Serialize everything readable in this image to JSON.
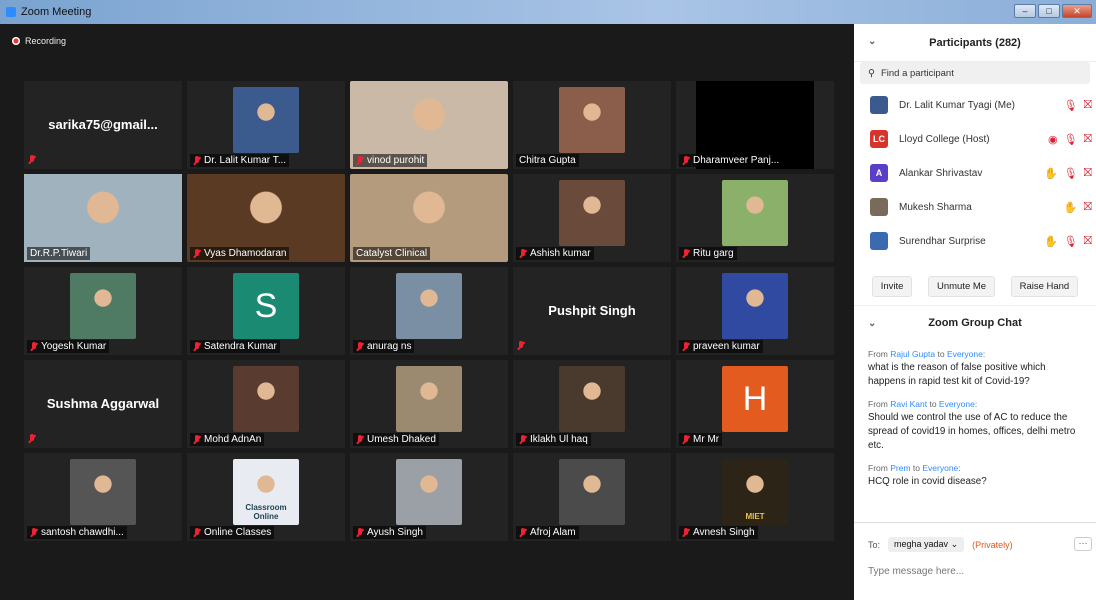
{
  "window": {
    "title": "Zoom Meeting",
    "min": "‒",
    "max": "□",
    "close": "✕"
  },
  "recording": "Recording",
  "tiles": [
    {
      "name": "sarika75@gmail...",
      "type": "name"
    },
    {
      "name": "Dr. Lalit Kumar T...",
      "type": "photo",
      "color": "#3b5b8f"
    },
    {
      "name": "vinod purohit",
      "type": "wide",
      "color": "#c9b9a6"
    },
    {
      "name": "Chitra Gupta",
      "type": "photo",
      "color": "#8a5e4a"
    },
    {
      "name": "Dharamveer Panj...",
      "type": "black"
    },
    {
      "name": "Dr.R.P.Tiwari",
      "type": "wide",
      "color": "#9fb2bd",
      "active": true
    },
    {
      "name": "Vyas Dhamodaran",
      "type": "wide",
      "color": "#5a3a22"
    },
    {
      "name": "Catalyst Clinical",
      "type": "wide",
      "color": "#b59b7d"
    },
    {
      "name": "Ashish kumar",
      "type": "photo",
      "color": "#6a4a3a"
    },
    {
      "name": "Ritu garg",
      "type": "photo",
      "color": "#8bb06a"
    },
    {
      "name": "Yogesh Kumar",
      "type": "photo",
      "color": "#4f7a63"
    },
    {
      "name": "Satendra Kumar",
      "type": "avatar-s",
      "letter": "S"
    },
    {
      "name": "anurag ns",
      "type": "photo",
      "color": "#7a8ea4"
    },
    {
      "name": "Pushpit Singh",
      "type": "name"
    },
    {
      "name": "praveen kumar",
      "type": "photo",
      "color": "#2f4aa0"
    },
    {
      "name": "Sushma Aggarwal",
      "type": "name"
    },
    {
      "name": "Mohd AdnAn",
      "type": "photo",
      "color": "#5a3b2f"
    },
    {
      "name": "Umesh Dhaked",
      "type": "photo",
      "color": "#9b8a70"
    },
    {
      "name": "Iklakh Ul haq",
      "type": "photo",
      "color": "#4a3a2e"
    },
    {
      "name": "Mr Mr",
      "type": "avatar-h",
      "letter": "H"
    },
    {
      "name": "santosh chawdhi...",
      "type": "photo",
      "color": "#555555"
    },
    {
      "name": "Online Classes",
      "type": "photo",
      "color": "#e8ecf2",
      "caption": "Classroom Online"
    },
    {
      "name": "Ayush Singh",
      "type": "photo",
      "color": "#9aa0a6"
    },
    {
      "name": "Afroj Alam",
      "type": "photo",
      "color": "#4b4b4b"
    },
    {
      "name": "Avnesh Singh",
      "type": "photo",
      "color": "#2c2416",
      "caption": "MIET"
    }
  ],
  "participants": {
    "title": "Participants (282)",
    "search_placeholder": "Find a participant",
    "list": [
      {
        "name": "Dr. Lalit Kumar Tyagi (Me)",
        "av": "",
        "avcolor": "#3b5b8f"
      },
      {
        "name": "Lloyd College (Host)",
        "av": "LC",
        "avcolor": "#d7342b"
      },
      {
        "name": "Alankar Shrivastav",
        "av": "A",
        "avcolor": "#5a3ec8"
      },
      {
        "name": "Mukesh Sharma",
        "av": "",
        "avcolor": "#7a6a5a"
      },
      {
        "name": "Surendhar Surprise",
        "av": "",
        "avcolor": "#3a6ab0"
      }
    ],
    "buttons": [
      "Invite",
      "Unmute Me",
      "Raise Hand"
    ]
  },
  "chat": {
    "title": "Zoom Group Chat",
    "messages": [
      {
        "from": "Rajul Gupta",
        "to": "Everyone",
        "text": "what is the reason of false positive which happens in rapid test kit of Covid-19?"
      },
      {
        "from": "Ravi Kant",
        "to": "Everyone",
        "text": "Should we control the use of AC  to reduce the spread of  covid19 in  homes, offices, delhi metro etc."
      },
      {
        "from": "Prem",
        "to": "Everyone",
        "text": "HCQ role in covid disease?"
      }
    ],
    "from_word": "From",
    "to_word": "to",
    "to_label": "To:",
    "recipient": "megha yadav",
    "privately": "(Privately)",
    "more": "···",
    "placeholder": "Type message here..."
  }
}
